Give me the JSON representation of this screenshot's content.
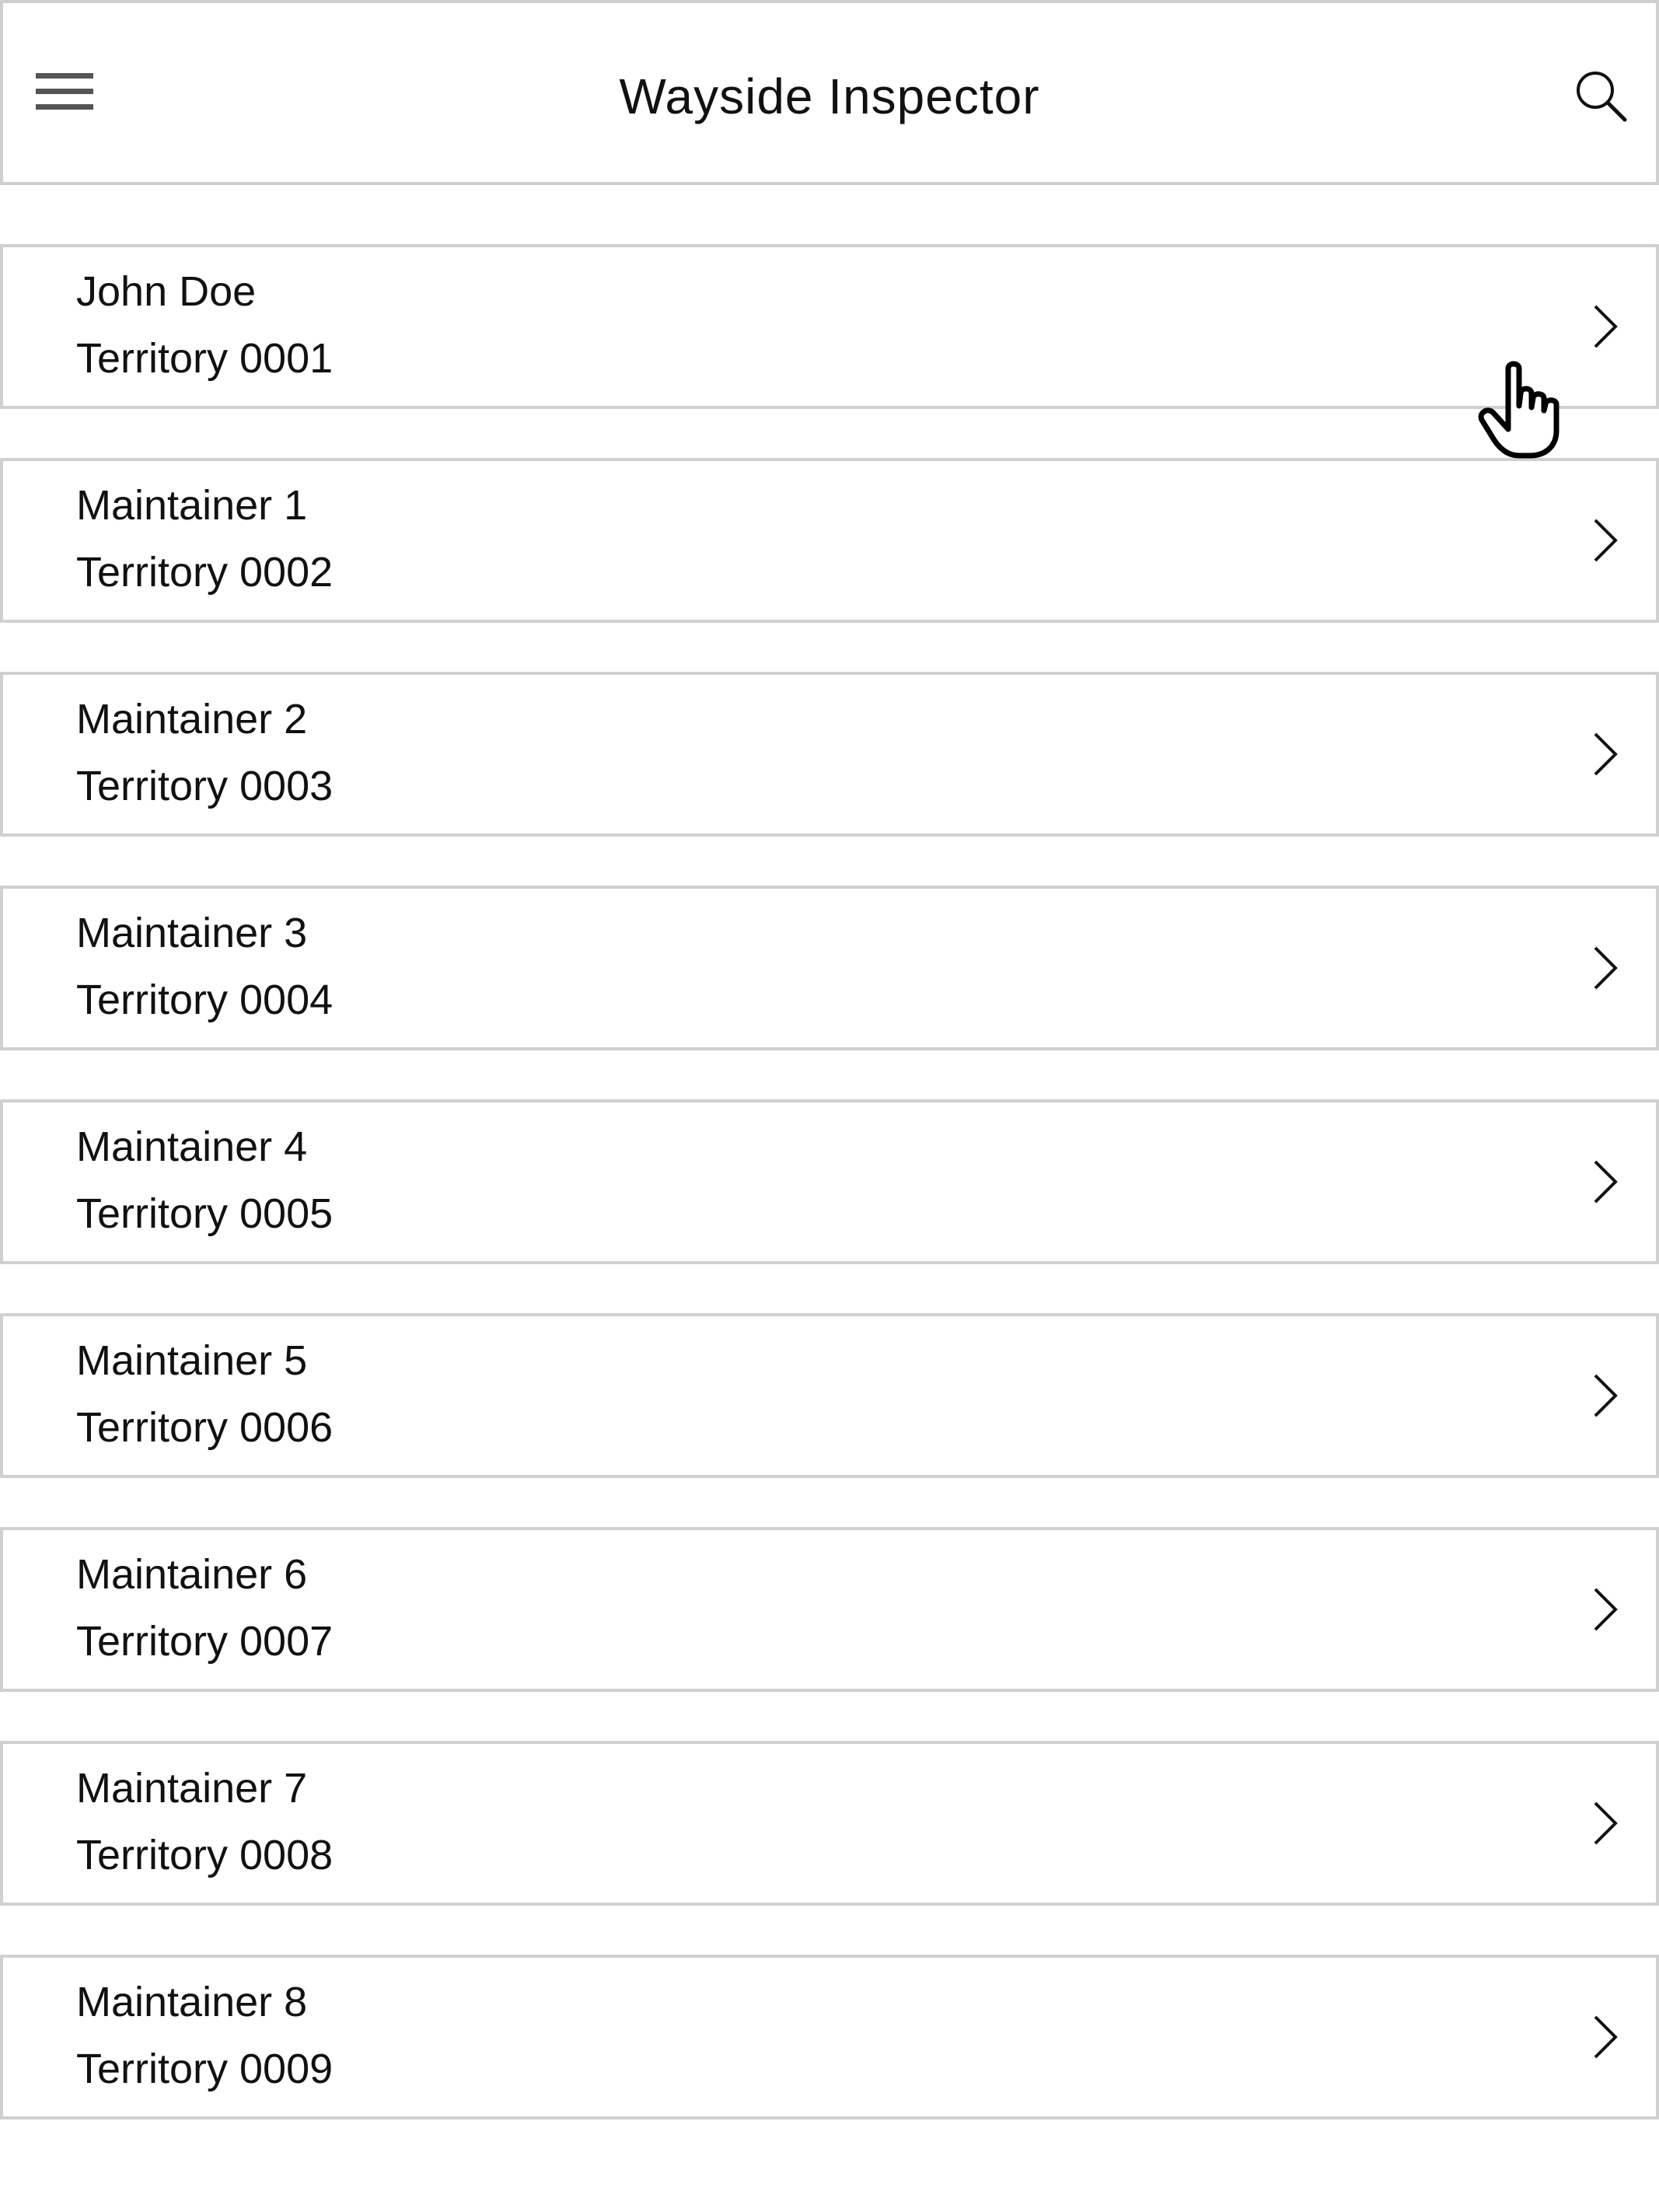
{
  "app": {
    "title": "Wayside Inspector"
  },
  "header": {
    "menu_icon": "hamburger-menu-icon",
    "search_icon": "search-icon"
  },
  "maintainers": [
    {
      "name": "John Doe",
      "territory": "Territory 0001"
    },
    {
      "name": "Maintainer 1",
      "territory": "Territory 0002"
    },
    {
      "name": "Maintainer 2",
      "territory": "Territory 0003"
    },
    {
      "name": "Maintainer 3",
      "territory": "Territory 0004"
    },
    {
      "name": "Maintainer 4",
      "territory": "Territory 0005"
    },
    {
      "name": "Maintainer 5",
      "territory": "Territory 0006"
    },
    {
      "name": "Maintainer 6",
      "territory": "Territory 0007"
    },
    {
      "name": "Maintainer 7",
      "territory": "Territory 0008"
    },
    {
      "name": "Maintainer 8",
      "territory": "Territory 0009"
    }
  ],
  "row_icon": "chevron-right-icon",
  "pointer_icon": "hand-pointer-cursor-icon",
  "colors": {
    "border": "#d0d0d0",
    "text": "#111111",
    "icon": "#555555",
    "background": "#ffffff"
  }
}
